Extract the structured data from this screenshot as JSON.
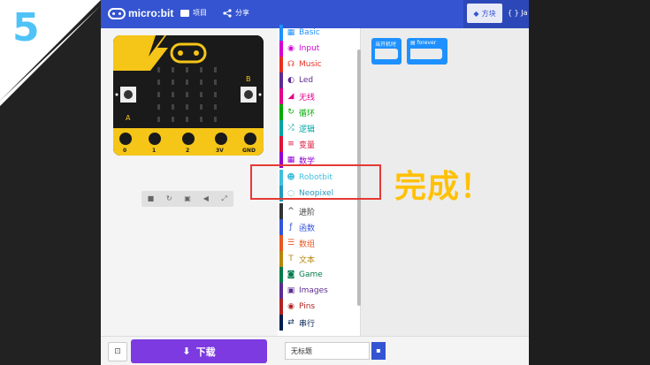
{
  "step_number": "5",
  "header": {
    "logo_text": "micro:bit",
    "projects_label": "项目",
    "share_label": "分享",
    "tab_blocks": "方块",
    "tab_js": "{ } Ja"
  },
  "board": {
    "pins": [
      "0",
      "1",
      "2",
      "3V",
      "GND"
    ],
    "button_a": "A",
    "button_b": "B"
  },
  "toolbox": {
    "categories": [
      {
        "label": "Basic",
        "color": "#1e90ff",
        "icon": "grid-icon"
      },
      {
        "label": "Input",
        "color": "#d400d4",
        "icon": "circle-dot-icon"
      },
      {
        "label": "Music",
        "color": "#e63022",
        "icon": "headphones-icon"
      },
      {
        "label": "Led",
        "color": "#5c2d91",
        "icon": "toggle-icon"
      },
      {
        "label": "无线",
        "color": "#e3008c",
        "icon": "signal-icon"
      },
      {
        "label": "循环",
        "color": "#00aa00",
        "icon": "loop-icon"
      },
      {
        "label": "逻辑",
        "color": "#00a4a6",
        "icon": "shuffle-icon"
      },
      {
        "label": "变量",
        "color": "#dc143c",
        "icon": "list-icon"
      },
      {
        "label": "数学",
        "color": "#9400d3",
        "icon": "calculator-icon"
      },
      {
        "label": "Robotbit",
        "color": "#3fbfde",
        "icon": "robot-icon"
      },
      {
        "label": "Neopixel",
        "color": "#2699bf",
        "icon": "spinner-icon"
      },
      {
        "label": "进阶",
        "color": "#333333",
        "icon": "chevron-up-icon"
      },
      {
        "label": "函数",
        "color": "#3455db",
        "icon": "function-icon"
      },
      {
        "label": "数组",
        "color": "#e65722",
        "icon": "list-ol-icon"
      },
      {
        "label": "文本",
        "color": "#b8860b",
        "icon": "text-icon"
      },
      {
        "label": "Game",
        "color": "#007a4b",
        "icon": "gamepad-icon"
      },
      {
        "label": "Images",
        "color": "#5c2d91",
        "icon": "image-icon"
      },
      {
        "label": "Pins",
        "color": "#b22222",
        "icon": "pin-icon"
      },
      {
        "label": "串行",
        "color": "#002050",
        "icon": "exchange-icon"
      }
    ]
  },
  "workspace": {
    "block_on_start": "当开机时",
    "block_forever": "forever"
  },
  "footer": {
    "download_label": "下载",
    "project_name": "无标题"
  },
  "annotation": {
    "done_text": "完成！"
  },
  "colors": {
    "header": "#3454d1",
    "download": "#7c3ae0",
    "highlight": "#e53935",
    "done": "#ffc107",
    "step": "#4fc3f7"
  }
}
